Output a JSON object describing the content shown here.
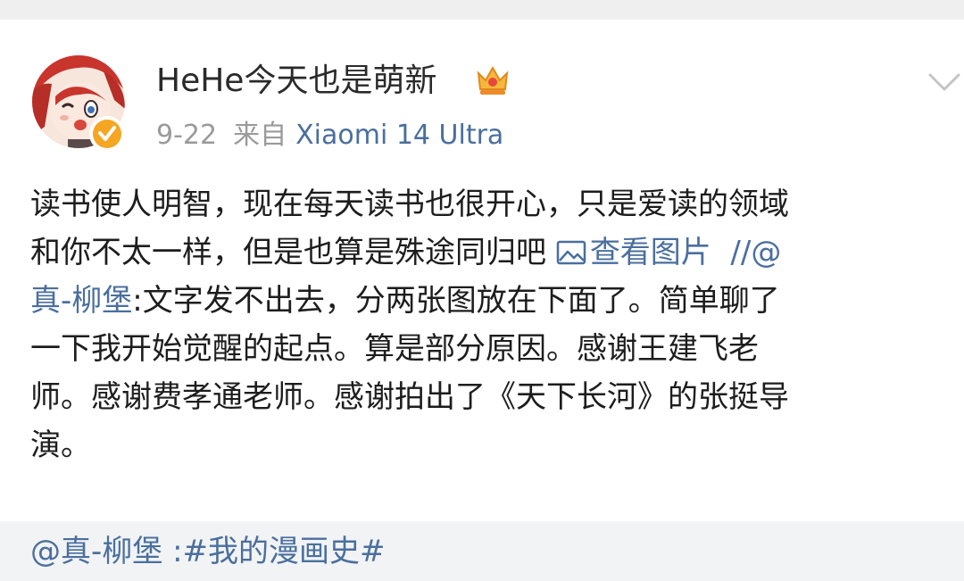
{
  "post": {
    "username": "HeHe今天也是萌新",
    "crown_icon": "crown-icon",
    "verified_icon": "verified-badge-icon",
    "date": "9-22",
    "from_label": "来自",
    "device": "Xiaomi 14 Ultra",
    "content": {
      "line1": "读书使人明智，现在每天读书也很开心，只是爱读的领域",
      "line2_text": "和你不太一样，但是也算是殊途同归吧 ",
      "view_image_label": "查看图片",
      "line2_tail": "  //@",
      "line3_mention": "真-柳堡",
      "line3_text": ":文字发不出去，分两张图放在下面了。简单聊了",
      "line4": "一下我开始觉醒的起点。算是部分原因。感谢王建飞老",
      "line5": "师。感谢费孝通老师。感谢拍出了《天下长河》的张挺导",
      "line6": "演。"
    }
  },
  "repost_bar": {
    "text": "@真-柳堡 :#我的漫画史#"
  },
  "colors": {
    "link": "#4a6f9e",
    "text": "#1d1d1d",
    "meta": "#9a9a9a",
    "bar_bg": "#f2f3f5"
  }
}
